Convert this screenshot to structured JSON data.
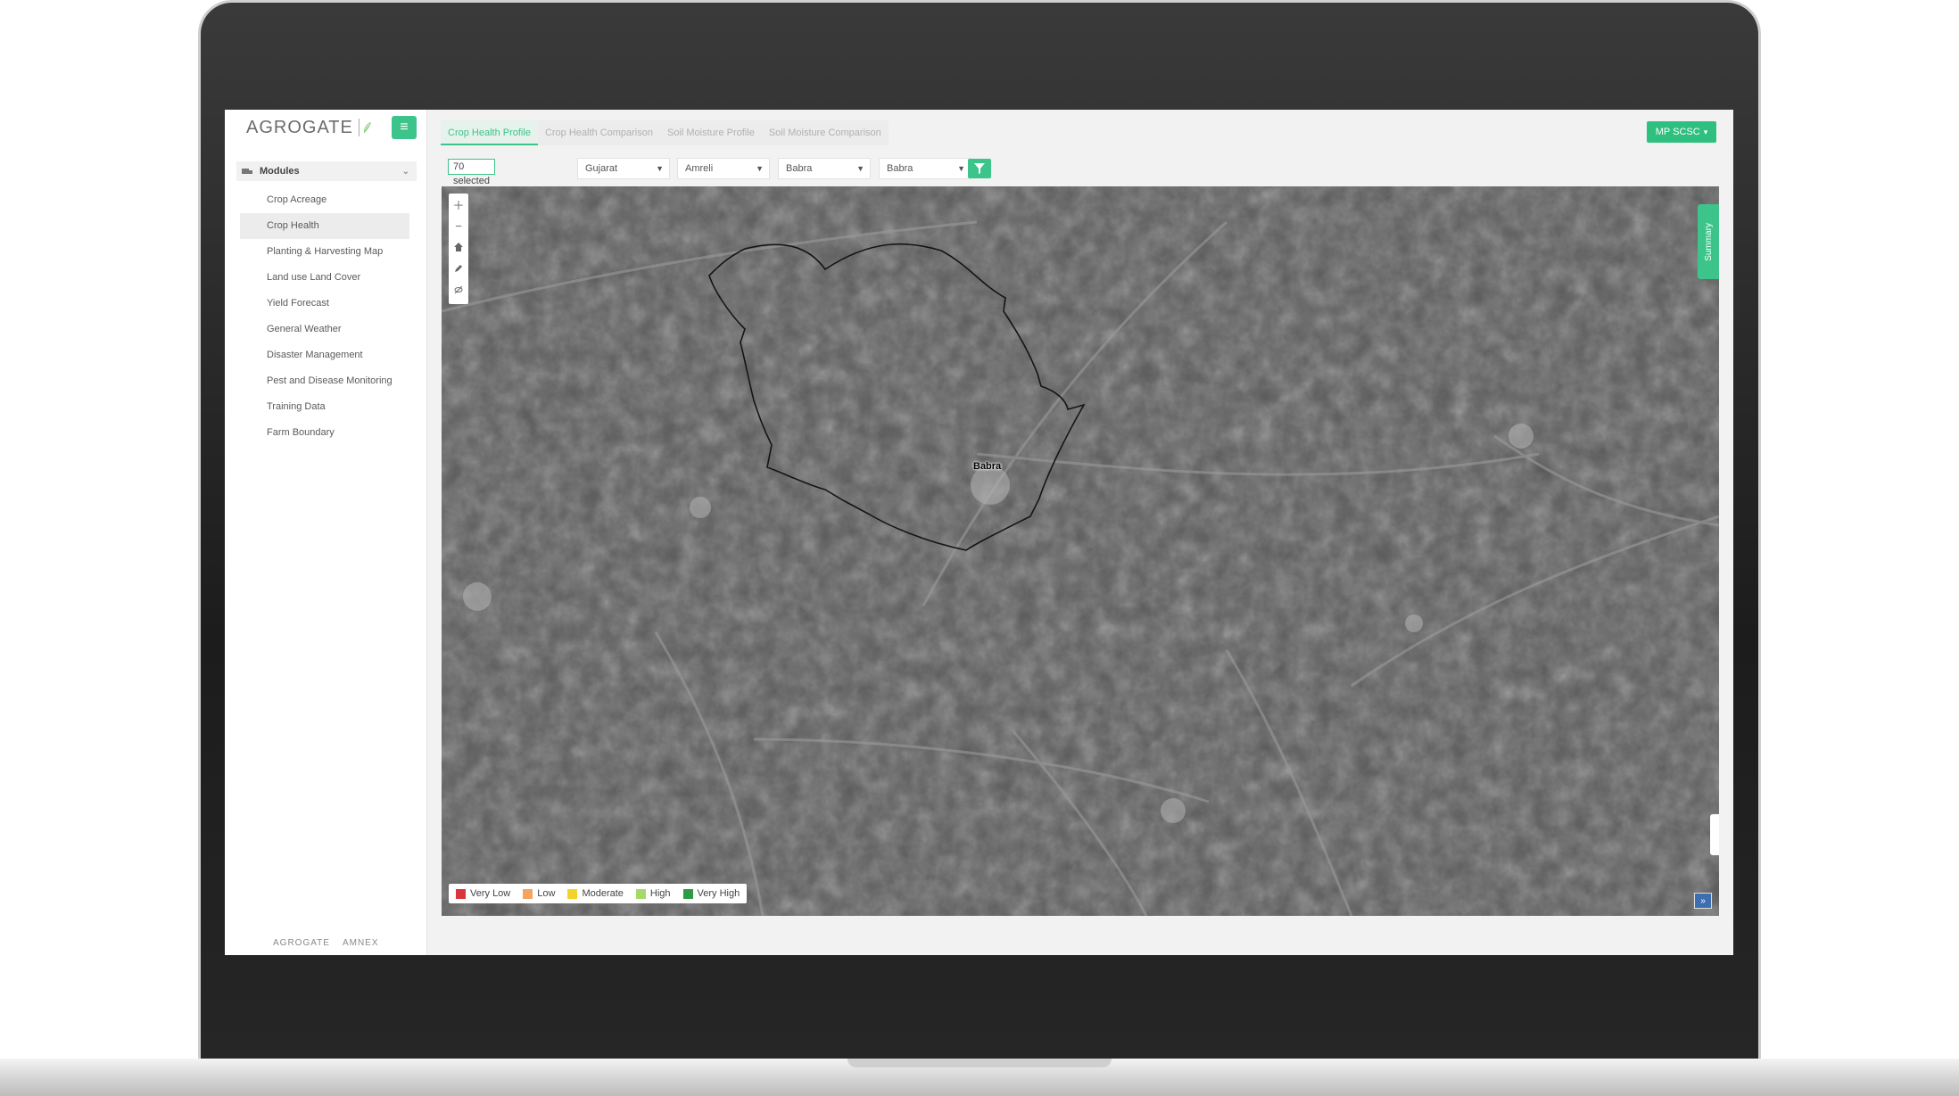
{
  "sidebar": {
    "brand": "AGROGATE",
    "modules_header": "Modules",
    "items": [
      {
        "label": "Crop Acreage"
      },
      {
        "label": "Crop Health"
      },
      {
        "label": "Planting & Harvesting Map"
      },
      {
        "label": "Land use Land Cover"
      },
      {
        "label": "Yield Forecast"
      },
      {
        "label": "General Weather"
      },
      {
        "label": "Disaster Management"
      },
      {
        "label": "Pest and Disease Monitoring"
      },
      {
        "label": "Training Data"
      },
      {
        "label": "Farm Boundary"
      }
    ],
    "footer_brand": "AGROGATE",
    "footer_partner": "AMNEX"
  },
  "tabs": [
    {
      "label": "Crop Health Profile"
    },
    {
      "label": "Crop Health Comparison"
    },
    {
      "label": "Soil Moisture Profile"
    },
    {
      "label": "Soil Moisture Comparison"
    }
  ],
  "org_button": "MP SCSC",
  "filters": {
    "selected_tag": "70 selected",
    "state": "Gujarat",
    "district": "Amreli",
    "taluka": "Babra",
    "village": "Babra"
  },
  "map": {
    "place_label": "Babra",
    "summary_label": "Summary",
    "legend": [
      {
        "label": "Very Low",
        "color": "#d9353b"
      },
      {
        "label": "Low",
        "color": "#f4a460"
      },
      {
        "label": "Moderate",
        "color": "#f2d32c"
      },
      {
        "label": "High",
        "color": "#a6d96a"
      },
      {
        "label": "Very High",
        "color": "#2e9a47"
      }
    ]
  },
  "colors": {
    "accent": "#3cc48b"
  }
}
